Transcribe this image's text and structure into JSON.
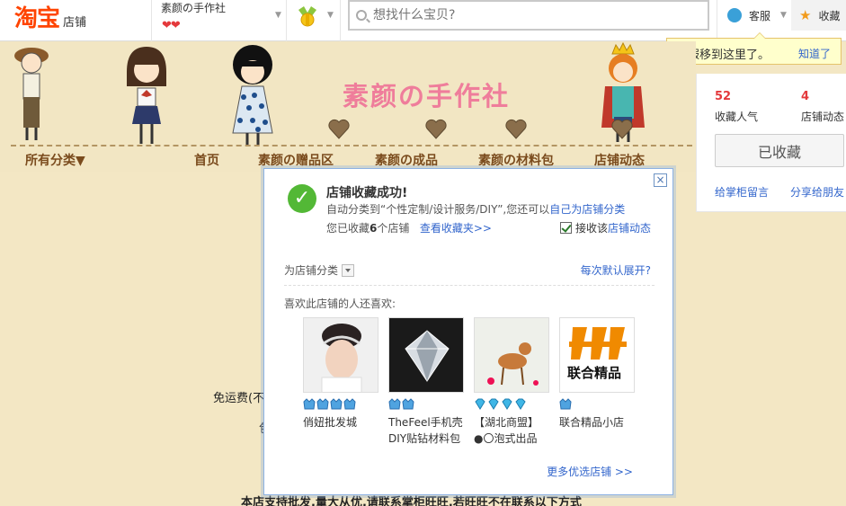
{
  "topbar": {
    "logo_main": "淘宝",
    "logo_sub": "店铺",
    "shop_name": "素颜の手作社",
    "hearts": "❤❤",
    "search_placeholder": "想找什么宝贝?",
    "service_label": "客服",
    "favorite_label": "收藏"
  },
  "tooltip": {
    "text": "客服移到这里了。",
    "link": "知道了"
  },
  "side_panel": {
    "stats": [
      {
        "value": "52",
        "label": "收藏人气"
      },
      {
        "value": "4",
        "label": "店铺动态"
      }
    ],
    "collected_button": "已收藏",
    "links": [
      "给掌柜留言",
      "分享给朋友"
    ]
  },
  "banner": {
    "title": "素颜の手作社",
    "nav": [
      "所有分类▼",
      "首页",
      "素颜の赠品区",
      "素颜の成品",
      "素颜の材料包",
      "店铺动态"
    ]
  },
  "background_text": {
    "line1": "免运费(不",
    "line2": "包",
    "line3": "本店支持批发,量大从优,请联系掌柜旺旺,若旺旺不在联系以下方式"
  },
  "dialog": {
    "close": "×",
    "title": "店铺收藏成功!",
    "line1_prefix": "自动分类到“个性定制/设计服务/DIY”,您还可以",
    "line1_link": "自己为店铺分类",
    "line2_prefix": "您已收藏",
    "line2_count": "6",
    "line2_suffix": "个店铺",
    "line2_link": "查看收藏夹>>",
    "checkbox_prefix": "接收该",
    "checkbox_link": "店铺动态",
    "category_label": "为店铺分类",
    "expand_link": "每次默认展开?",
    "like_title": "喜欢此店铺的人还喜欢:",
    "shops": [
      {
        "name_lines": [
          "俏妞批发城"
        ],
        "gems": 4,
        "gem_type": "crown"
      },
      {
        "name_lines": [
          "TheFeel手机壳",
          "DIY贴钻材料包"
        ],
        "gems": 2,
        "gem_type": "crown"
      },
      {
        "name_lines": [
          "【湖北商盟】",
          "●〇泡式出品"
        ],
        "gems": 4,
        "gem_type": "diamond"
      },
      {
        "name_lines": [
          "联合精品小店"
        ],
        "gems": 1,
        "gem_type": "crown"
      }
    ],
    "img4_text": "联合精品",
    "more_link": "更多优选店铺 >>"
  },
  "colors": {
    "taobao_orange": "#ff4400",
    "link_blue": "#3366cc",
    "banner_bg": "#f2e6c3",
    "title_pink": "#ef7d9b",
    "stat_red": "#e4393c"
  }
}
